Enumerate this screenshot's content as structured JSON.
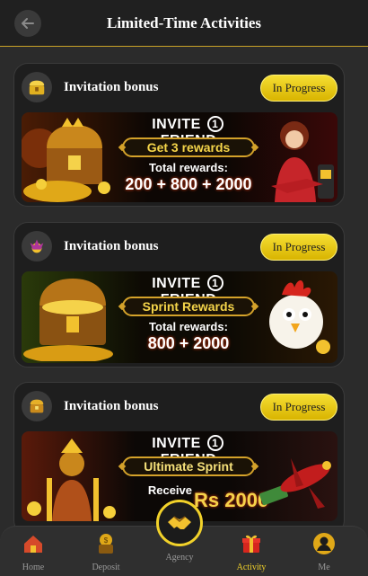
{
  "header": {
    "title": "Limited-Time Activities"
  },
  "cards": [
    {
      "title": "Invitation bonus",
      "status": "In Progress",
      "banner": {
        "line1_a": "INVITE",
        "line1_num": "1",
        "line1_b": "FRIEND",
        "subtitle": "Get 3 rewards",
        "total_label": "Total rewards:",
        "amounts": "200 + 800 + 2000"
      }
    },
    {
      "title": "Invitation bonus",
      "status": "In Progress",
      "banner": {
        "line1_a": "INVITE",
        "line1_num": "1",
        "line1_b": "FRIEND",
        "subtitle": "Sprint Rewards",
        "total_label": "Total rewards:",
        "amounts": "800 + 2000"
      }
    },
    {
      "title": "Invitation bonus",
      "status": "In Progress",
      "banner": {
        "line1_a": "INVITE",
        "line1_num": "1",
        "line1_b": "FRIEND",
        "subtitle": "Ultimate Sprint",
        "total_label": "Receive",
        "amounts": "Rs 2000"
      }
    }
  ],
  "nav": {
    "items": [
      {
        "label": "Home",
        "icon": "home-icon"
      },
      {
        "label": "Deposit",
        "icon": "deposit-icon"
      },
      {
        "label": "Agency",
        "icon": "handshake-icon"
      },
      {
        "label": "Activity",
        "icon": "gift-icon"
      },
      {
        "label": "Me",
        "icon": "profile-icon"
      }
    ],
    "active": "Activity",
    "accent": "#f2d22a"
  }
}
